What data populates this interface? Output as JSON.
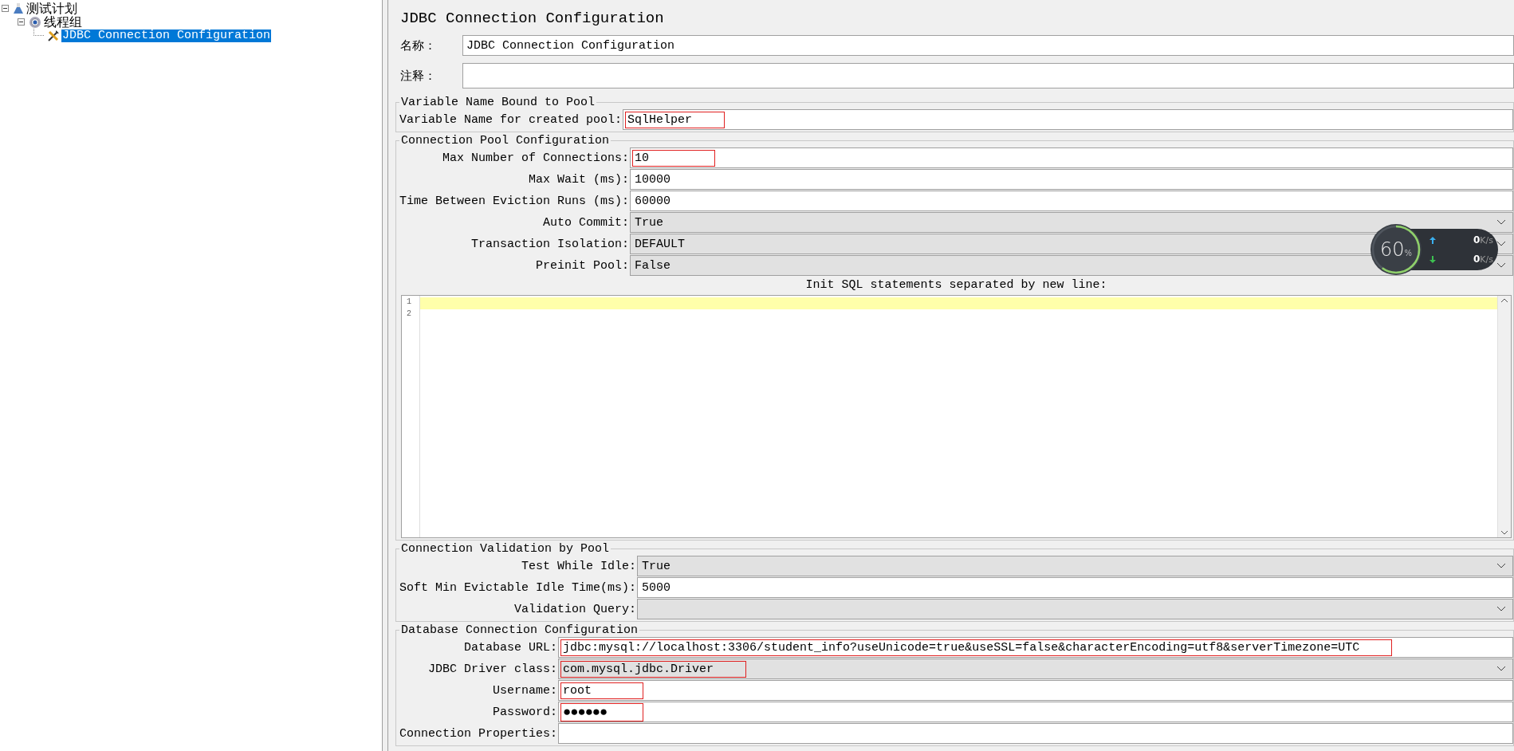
{
  "tree": [
    {
      "label": "测试计划",
      "kind": "flask",
      "expanded": true,
      "selected": false,
      "children": [
        {
          "label": "线程组",
          "kind": "gear",
          "expanded": true,
          "selected": false,
          "children": [
            {
              "label": "JDBC Connection Configuration",
              "kind": "tools",
              "selected": true
            }
          ]
        }
      ]
    }
  ],
  "panel": {
    "title": "JDBC Connection Configuration",
    "name_label": "名称：",
    "name_value": "JDBC Connection Configuration",
    "comments_label": "注释："
  },
  "sections": [
    {
      "title": "Variable Name Bound to Pool",
      "rows": [
        {
          "label": "Variable Name for created pool:",
          "kind": "text",
          "value": "SqlHelper",
          "highlighted": true
        }
      ]
    },
    {
      "title": "Connection Pool Configuration",
      "rows": [
        {
          "label": "Max Number of Connections:",
          "kind": "text",
          "value": "10",
          "highlighted": true
        },
        {
          "label": "Max Wait (ms):",
          "kind": "text",
          "value": "10000",
          "highlighted": false
        },
        {
          "label": "Time Between Eviction Runs (ms):",
          "kind": "text",
          "value": "60000",
          "highlighted": false
        },
        {
          "label": "Auto Commit:",
          "kind": "combo",
          "value": "True",
          "highlighted": false
        },
        {
          "label": "Transaction Isolation:",
          "kind": "combo",
          "value": "DEFAULT",
          "highlighted": false
        },
        {
          "label": "Preinit Pool:",
          "kind": "combo",
          "value": "False",
          "highlighted": false
        }
      ],
      "editor": {
        "label": "Init SQL statements separated by new line:",
        "lines": [
          {
            "number": "1",
            "current": true
          },
          {
            "number": "2",
            "current": false
          }
        ]
      }
    },
    {
      "title": "Connection Validation by Pool",
      "rows": [
        {
          "label": "Test While Idle:",
          "kind": "combo",
          "value": "True",
          "highlighted": false
        },
        {
          "label": "Soft Min Evictable Idle Time(ms):",
          "kind": "text",
          "value": "5000",
          "highlighted": false
        },
        {
          "label": "Validation Query:",
          "kind": "combo",
          "highlighted": false
        }
      ]
    },
    {
      "title": "Database Connection Configuration",
      "rows": [
        {
          "label": "Database URL:",
          "kind": "text",
          "value": "jdbc:mysql://localhost:3306/student_info?useUnicode=true&useSSL=false&characterEncoding=utf8&serverTimezone=UTC",
          "highlighted": true
        },
        {
          "label": "JDBC Driver class:",
          "kind": "combo",
          "value": "com.mysql.jdbc.Driver",
          "highlighted": true
        },
        {
          "label": "Username:",
          "kind": "text",
          "value": "root",
          "highlighted": true
        },
        {
          "label": "Password:",
          "kind": "password",
          "value": "●●●●●●",
          "highlighted": true
        },
        {
          "label": "Connection Properties:",
          "kind": "text",
          "highlighted": false
        }
      ]
    }
  ],
  "speed_widget": {
    "percent": "60",
    "percent_unit": "%",
    "upload": "0",
    "upload_unit": "K/s",
    "download": "0",
    "download_unit": "K/s"
  }
}
